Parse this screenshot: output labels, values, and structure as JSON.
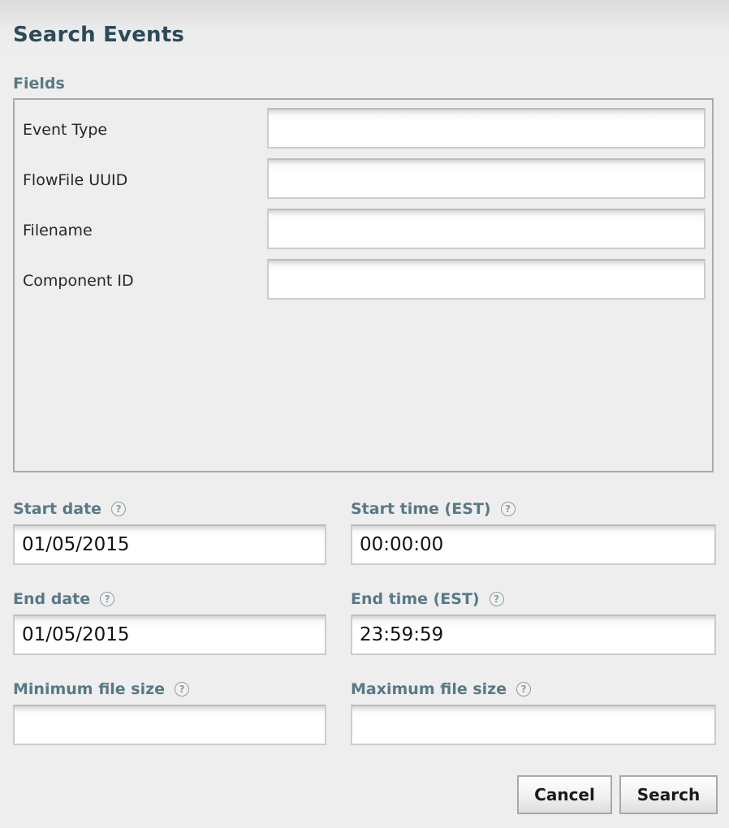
{
  "dialog": {
    "title": "Search Events"
  },
  "fields_section": {
    "label": "Fields",
    "fields": [
      {
        "label": "Event Type",
        "value": ""
      },
      {
        "label": "FlowFile UUID",
        "value": ""
      },
      {
        "label": "Filename",
        "value": ""
      },
      {
        "label": "Component ID",
        "value": ""
      }
    ]
  },
  "start_date": {
    "label": "Start date",
    "value": "01/05/2015",
    "help_icon": "help-icon"
  },
  "start_time": {
    "label": "Start time (EST)",
    "value": "00:00:00",
    "help_icon": "help-icon"
  },
  "end_date": {
    "label": "End date",
    "value": "01/05/2015",
    "help_icon": "help-icon"
  },
  "end_time": {
    "label": "End time (EST)",
    "value": "23:59:59",
    "help_icon": "help-icon"
  },
  "min_file_size": {
    "label": "Minimum file size",
    "value": "",
    "help_icon": "help-icon"
  },
  "max_file_size": {
    "label": "Maximum file size",
    "value": "",
    "help_icon": "help-icon"
  },
  "buttons": {
    "cancel": "Cancel",
    "search": "Search"
  },
  "colors": {
    "title": "#2c4a59",
    "section_label": "#587987",
    "background": "#eeeeee",
    "border": "#aaaaaa"
  }
}
